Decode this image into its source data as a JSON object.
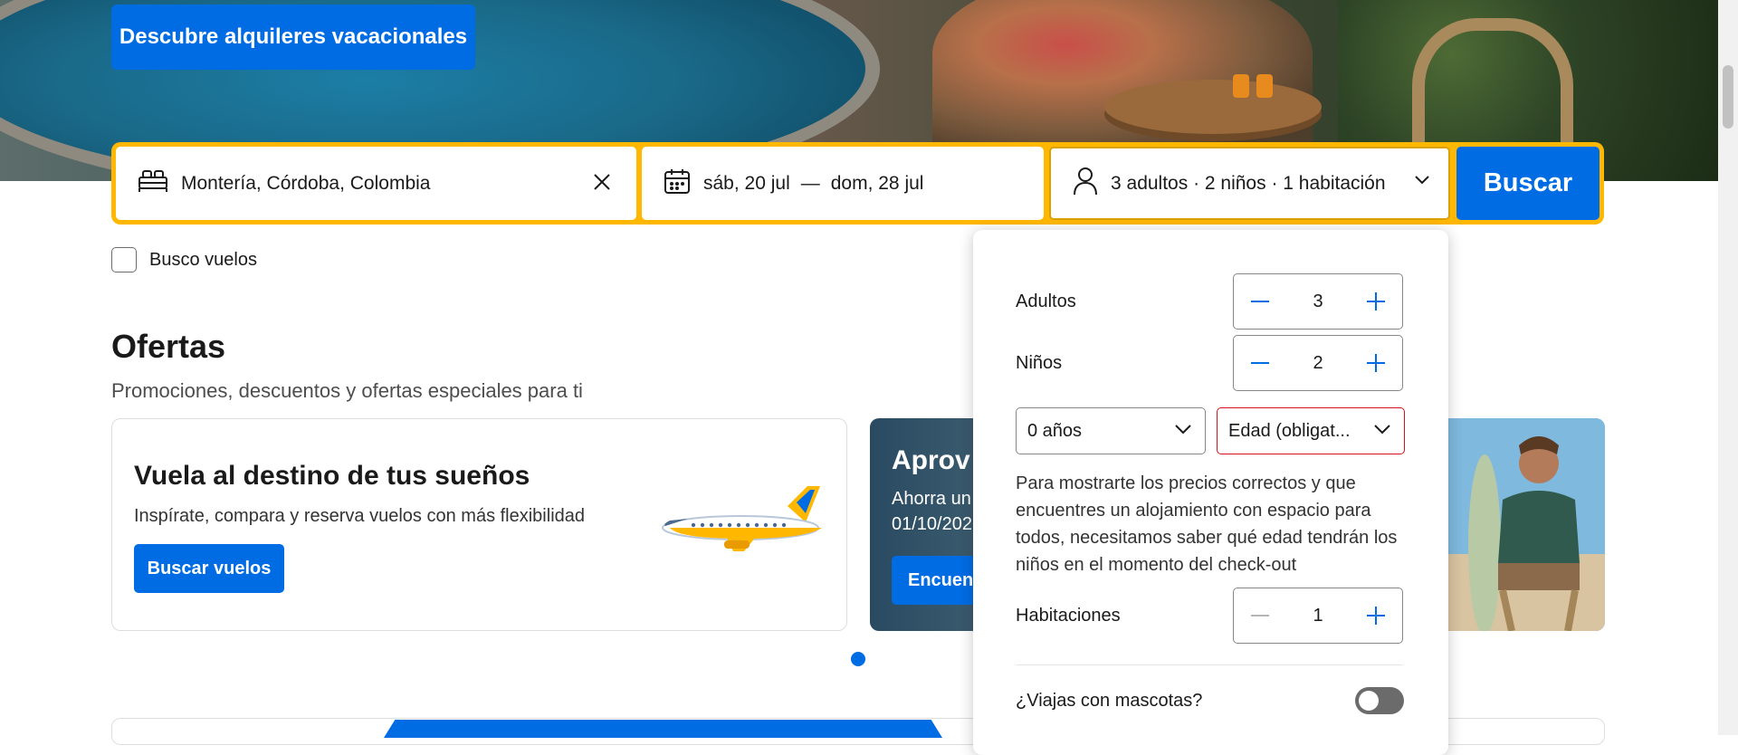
{
  "hero": {
    "cta_label": "Descubre alquileres vacacionales"
  },
  "search": {
    "destination_value": "Montería, Córdoba, Colombia",
    "checkin": "sáb, 20 jul",
    "date_separator": "—",
    "checkout": "dom, 28 jul",
    "occupancy_summary": "3 adultos · 2 niños · 1 habitación",
    "submit_label": "Buscar",
    "flights_checkbox_label": "Busco vuelos"
  },
  "offers": {
    "title": "Ofertas",
    "subtitle": "Promociones, descuentos y ofertas especiales para ti",
    "card1": {
      "title": "Vuela al destino de tus sueños",
      "description": "Inspírate, compara y reserva vuelos con más flexibilidad",
      "cta": "Buscar vuelos"
    },
    "card2": {
      "title": "Aprov",
      "line1": "Ahorra un",
      "line2": "01/10/202",
      "cta": "Encuent"
    }
  },
  "occupancy": {
    "adults_label": "Adultos",
    "adults_value": "3",
    "children_label": "Niños",
    "children_value": "2",
    "child1_age": "0 años",
    "child2_age_placeholder": "Edad (obligat...",
    "info_text": "Para mostrarte los precios correctos y que encuentres un alojamiento con espacio para todos, necesitamos saber qué edad tendrán los niños en el momento del check-out",
    "rooms_label": "Habitaciones",
    "rooms_value": "1",
    "pets_label": "¿Viajas con mascotas?",
    "pets_enabled": false
  },
  "colors": {
    "brand_blue": "#006ce4",
    "search_border": "#ffb700",
    "error_red": "#d4111e"
  },
  "icons": {
    "destination": "bed-icon",
    "dates": "calendar-icon",
    "occupancy": "person-icon",
    "clear": "close-icon",
    "dropdown": "chevron-down-icon",
    "increment": "plus-icon",
    "decrement": "minus-icon"
  }
}
